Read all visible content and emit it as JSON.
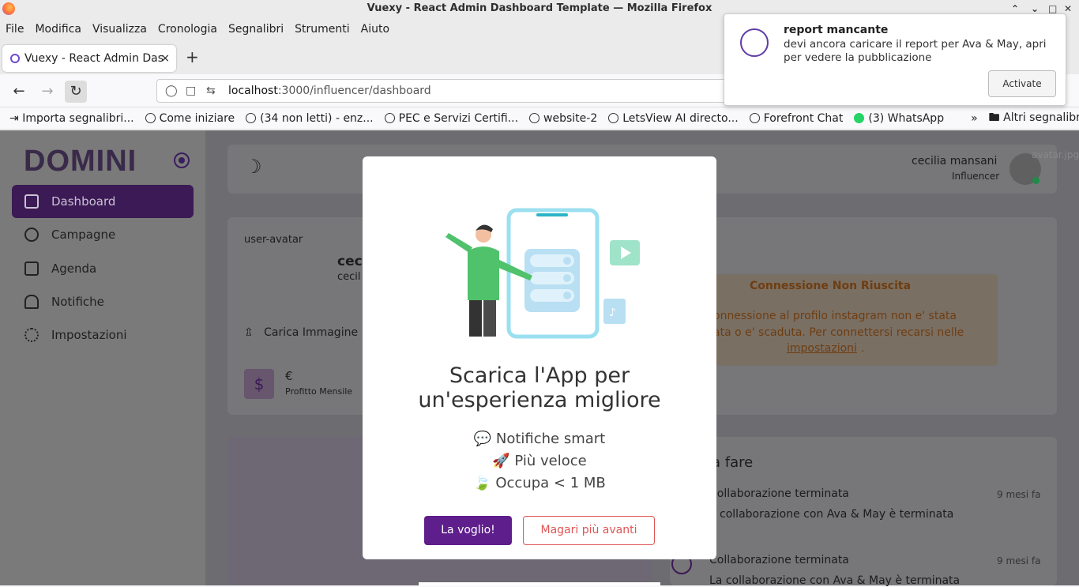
{
  "window": {
    "title": "Vuexy - React Admin Dashboard Template — Mozilla Firefox"
  },
  "menu": [
    "File",
    "Modifica",
    "Visualizza",
    "Cronologia",
    "Segnalibri",
    "Strumenti",
    "Aiuto"
  ],
  "tab": {
    "label": "Vuexy - React Admin Das",
    "close": "×",
    "new": "+"
  },
  "url": {
    "host": "localhost",
    "path": ":3000/influencer/dashboard"
  },
  "bookmarks": [
    "Importa segnalibri...",
    "Come iniziare",
    "(34 non letti) - enz...",
    "PEC e Servizi Certifi...",
    "website-2",
    "LetsView AI directo...",
    "Forefront Chat",
    "(3) WhatsApp",
    "Altri segnalibri"
  ],
  "app": {
    "logo": "DOMINI",
    "nav": [
      "Dashboard",
      "Campagne",
      "Agenda",
      "Notifiche",
      "Impostazioni"
    ],
    "user": {
      "name": "cecilia mansani",
      "role": "Influencer",
      "avatar_alt": "avatar.jpg"
    },
    "profile": {
      "avatar_alt": "user-avatar",
      "name": "cec",
      "sub": "cecil",
      "upload": "Carica Immagine",
      "currency": "€",
      "monthly": "Profitto Mensile"
    },
    "alert": {
      "title": "Connessione Non Riuscita",
      "line1": "onnessione al profilo instagram non e' stata",
      "line2": "ata o e' scaduta. Per connettersi recarsi nelle",
      "link": "impostazioni",
      "end": "."
    },
    "todo": {
      "title": "la fare",
      "items": [
        {
          "title": "Collaborazione terminata",
          "time": "9 mesi fa",
          "desc": "a collaborazione con Ava & May è terminata"
        },
        {
          "title": "Collaborazione terminata",
          "time": "9 mesi fa",
          "desc": "La collaborazione con Ava & May è terminata"
        }
      ]
    }
  },
  "modal": {
    "title_line1": "Scarica l'App per",
    "title_line2": "un'esperienza migliore",
    "features": [
      "💬 Notifiche smart",
      "🚀 Più veloce",
      "🍃 Occupa < 1 MB"
    ],
    "primary": "La voglio!",
    "secondary": "Magari più avanti"
  },
  "notification": {
    "title": "report mancante",
    "message": "devi ancora caricare il report per Ava & May, apri per vedere la pubblicazione",
    "action": "Activate"
  }
}
